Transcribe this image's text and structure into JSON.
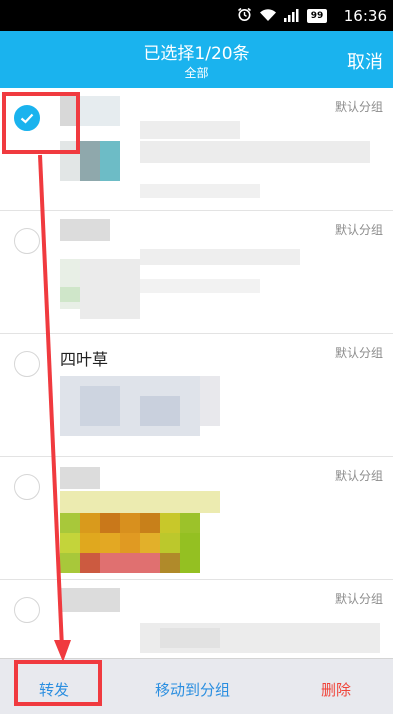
{
  "status_bar": {
    "time": "16:36",
    "battery": "99",
    "icons": [
      "alarm-icon",
      "wifi-icon",
      "signal-icon",
      "battery-icon"
    ]
  },
  "header": {
    "title": "已选择1/20条",
    "subtitle": "全部",
    "cancel_label": "取消"
  },
  "list": {
    "items": [
      {
        "name": "",
        "group": "默认分组",
        "selected": true
      },
      {
        "name": "",
        "group": "默认分组",
        "selected": false
      },
      {
        "name": "四叶草",
        "group": "默认分组",
        "selected": false
      },
      {
        "name": "",
        "group": "默认分组",
        "selected": false
      },
      {
        "name": "",
        "group": "默认分组",
        "selected": false
      }
    ]
  },
  "bottom_bar": {
    "forward_label": "转发",
    "move_label": "移动到分组",
    "delete_label": "删除"
  },
  "colors": {
    "accent": "#1ab3ee",
    "annotation": "#f03a3f",
    "delete": "#f0443a"
  }
}
